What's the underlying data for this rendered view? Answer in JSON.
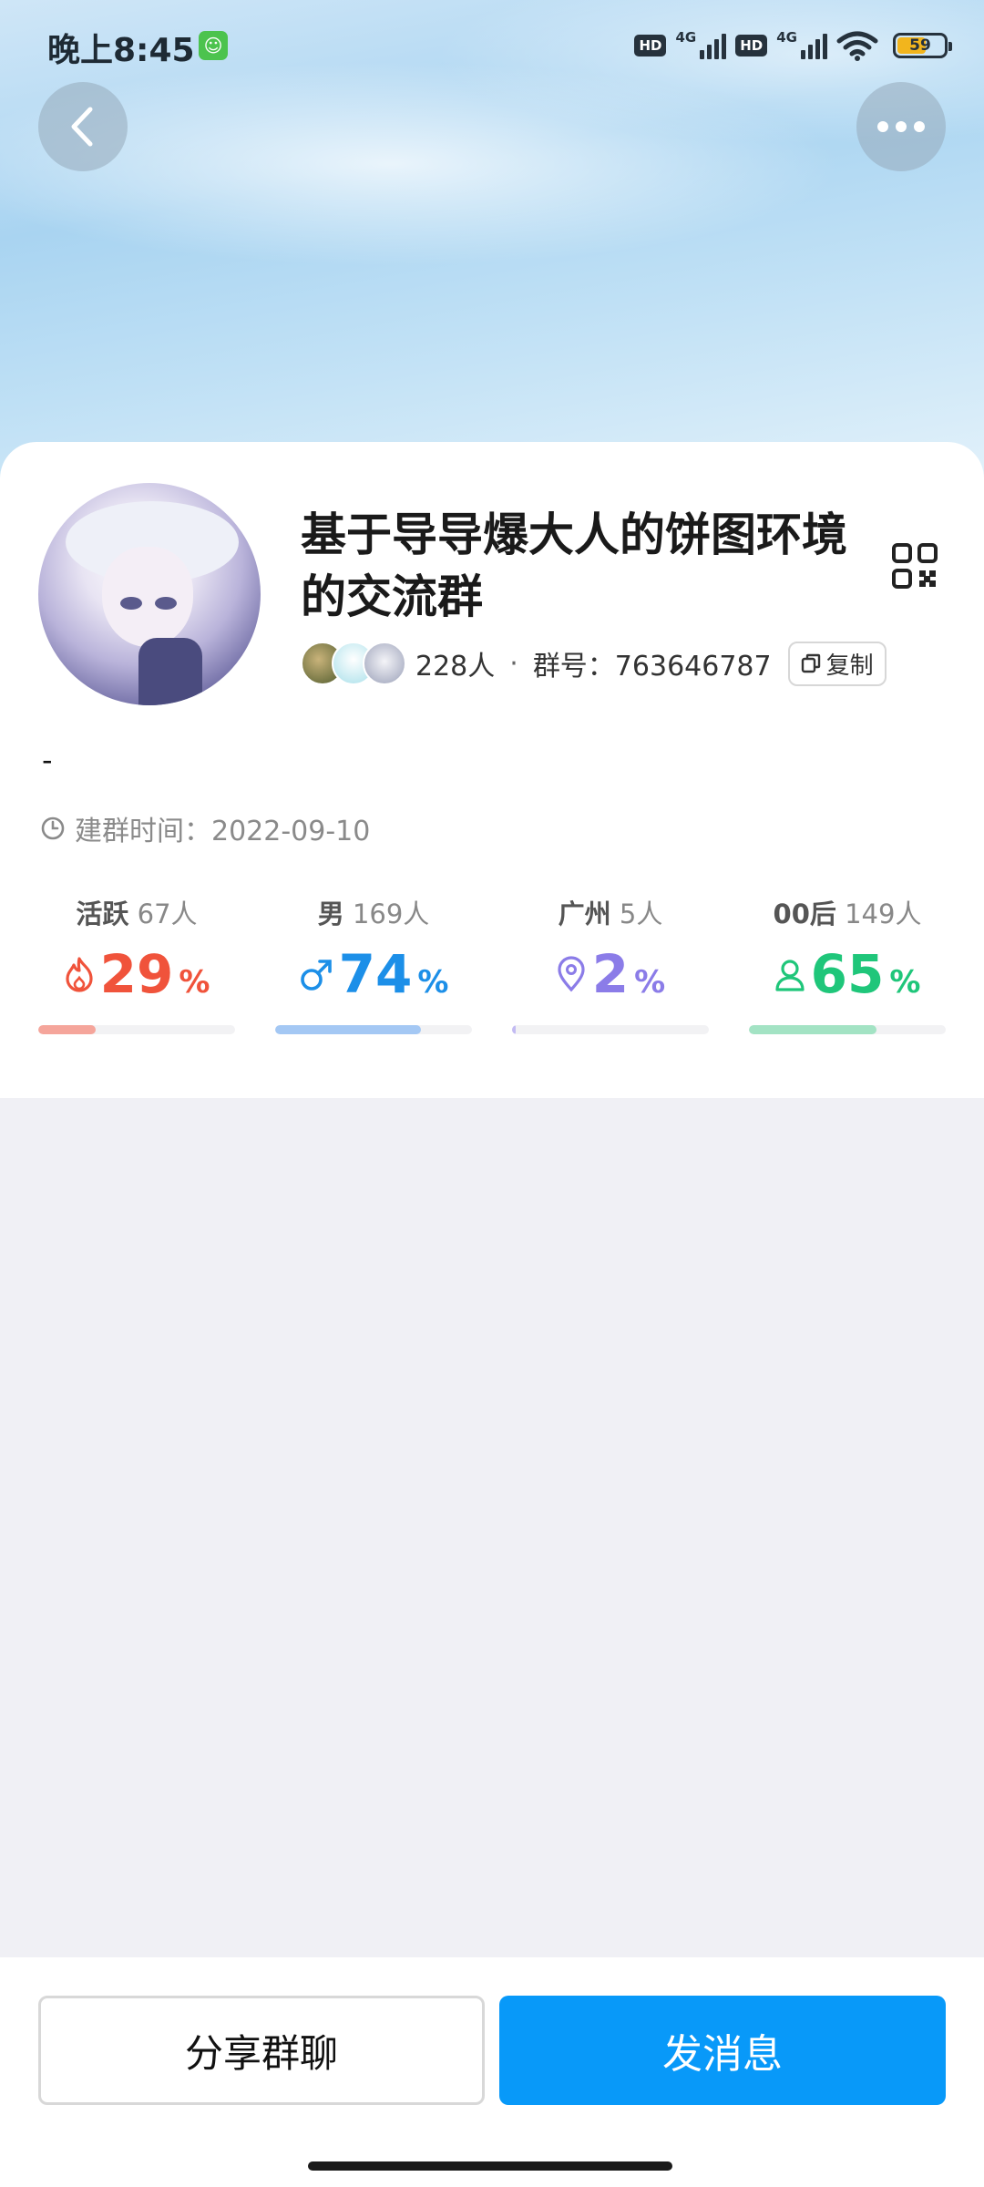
{
  "status_bar": {
    "time": "晚上8:45",
    "hd1": "HD",
    "net1": "4G",
    "hd2": "HD",
    "net2": "4G",
    "battery": "59"
  },
  "header": {
    "back_icon": "chevron-left-icon",
    "more_icon": "more-dots-icon"
  },
  "group": {
    "title": "基于导导爆大人的饼图环境的交流群",
    "member_count": "228人",
    "separator": "·",
    "group_number": "群号：763646787",
    "copy_label": "复制",
    "description": "-",
    "created": "建群时间：2022-09-10"
  },
  "stats": [
    {
      "label": "活跃",
      "count": "67人",
      "value": "29",
      "unit": "%",
      "color": "#f0533b",
      "bar_color": "#f5a59b",
      "fraction": 0.29,
      "icon": "fire-icon"
    },
    {
      "label": "男",
      "count": "169人",
      "value": "74",
      "unit": "%",
      "color": "#1c8fe8",
      "bar_color": "#a4c8f4",
      "fraction": 0.74,
      "icon": "male-icon"
    },
    {
      "label": "广州",
      "count": "5人",
      "value": "2",
      "unit": "%",
      "color": "#8b7ce8",
      "bar_color": "#c3bbf3",
      "fraction": 0.02,
      "icon": "location-pin-icon"
    },
    {
      "label": "00后",
      "count": "149人",
      "value": "65",
      "unit": "%",
      "color": "#1fc67a",
      "bar_color": "#a3e3c4",
      "fraction": 0.65,
      "icon": "person-icon"
    }
  ],
  "actions": {
    "share_label": "分享群聊",
    "send_label": "发消息",
    "send_color": "#0899f9"
  }
}
